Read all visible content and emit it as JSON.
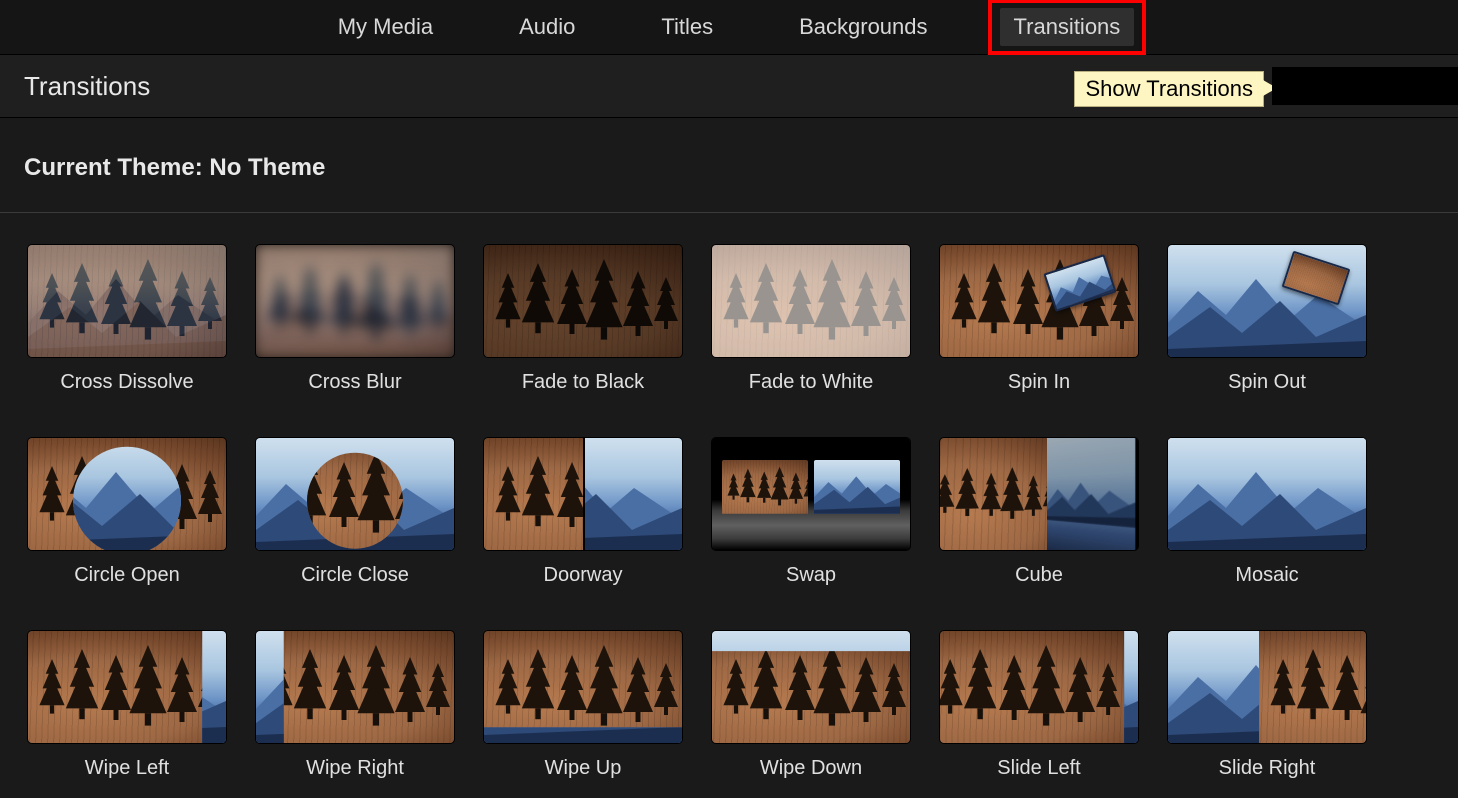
{
  "tabs": [
    "My Media",
    "Audio",
    "Titles",
    "Backgrounds",
    "Transitions"
  ],
  "active_tab_index": 4,
  "highlight_tab_index": 4,
  "section_title": "Transitions",
  "tooltip_text": "Show Transitions",
  "theme_line": "Current Theme: No Theme",
  "transitions": [
    {
      "name": "Cross Dissolve"
    },
    {
      "name": "Cross Blur"
    },
    {
      "name": "Fade to Black"
    },
    {
      "name": "Fade to White"
    },
    {
      "name": "Spin In"
    },
    {
      "name": "Spin Out"
    },
    {
      "name": "Circle Open"
    },
    {
      "name": "Circle Close"
    },
    {
      "name": "Doorway"
    },
    {
      "name": "Swap"
    },
    {
      "name": "Cube"
    },
    {
      "name": "Mosaic"
    },
    {
      "name": "Wipe Left"
    },
    {
      "name": "Wipe Right"
    },
    {
      "name": "Wipe Up"
    },
    {
      "name": "Wipe Down"
    },
    {
      "name": "Slide Left"
    },
    {
      "name": "Slide Right"
    }
  ]
}
